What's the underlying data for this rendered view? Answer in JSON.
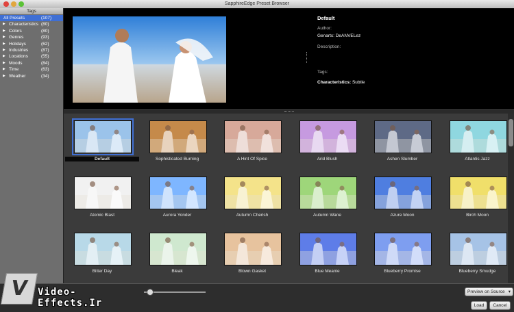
{
  "window": {
    "title": "SapphireEdge Preset Browser"
  },
  "sidebar": {
    "header": "Tags",
    "items": [
      {
        "label": "All Presets",
        "count": "(107)",
        "selected": true
      },
      {
        "label": "Characteristics",
        "count": "(80)"
      },
      {
        "label": "Colors",
        "count": "(80)"
      },
      {
        "label": "Genres",
        "count": "(93)"
      },
      {
        "label": "Holidays",
        "count": "(62)"
      },
      {
        "label": "Industries",
        "count": "(87)"
      },
      {
        "label": "Locations",
        "count": "(55)"
      },
      {
        "label": "Moods",
        "count": "(84)"
      },
      {
        "label": "Time",
        "count": "(63)"
      },
      {
        "label": "Weather",
        "count": "(34)"
      }
    ]
  },
  "preview": {
    "name": "Default",
    "author_label": "Author:",
    "genarts_label": "Genarts: DeANVELez",
    "description_label": "Description:",
    "tags_label": "Tags:",
    "characteristics_label": "Characteristics:",
    "characteristics_value": "Subtle"
  },
  "presets": [
    {
      "name": "Default",
      "tint": "#9cc4ea",
      "selected": true
    },
    {
      "name": "Sophisticated Burning",
      "tint": "#c58a4a"
    },
    {
      "name": "A Hint Of Spice",
      "tint": "#d8a99a"
    },
    {
      "name": "Arid Blush",
      "tint": "#c79ae0"
    },
    {
      "name": "Ashen Slumber",
      "tint": "#5f6a86"
    },
    {
      "name": "Atlantis Jazz",
      "tint": "#8fd8e0"
    },
    {
      "name": "Atomic Blast",
      "tint": "#f2f2f2"
    },
    {
      "name": "Aurora Yonder",
      "tint": "#7fb6ff"
    },
    {
      "name": "Autumn Cherish",
      "tint": "#f4e38a"
    },
    {
      "name": "Autumn Wane",
      "tint": "#9ed67a"
    },
    {
      "name": "Azure Moon",
      "tint": "#4f7fe0"
    },
    {
      "name": "Birch Moon",
      "tint": "#f0df6a"
    },
    {
      "name": "Bitter Day",
      "tint": "#b8d9e8"
    },
    {
      "name": "Bleak",
      "tint": "#cfe8cf"
    },
    {
      "name": "Blown Gasket",
      "tint": "#e7c49e"
    },
    {
      "name": "Blue Meanie",
      "tint": "#5f7de8"
    },
    {
      "name": "Blueberry Promise",
      "tint": "#7f9ef0"
    },
    {
      "name": "Blueberry Smudge",
      "tint": "#a6c4e6"
    }
  ],
  "footer": {
    "preview_select": "Preview on Source",
    "load_label": "Load",
    "cancel_label": "Cancel",
    "watermark": "Video-Effects.Ir",
    "watermark_logo": "V"
  }
}
